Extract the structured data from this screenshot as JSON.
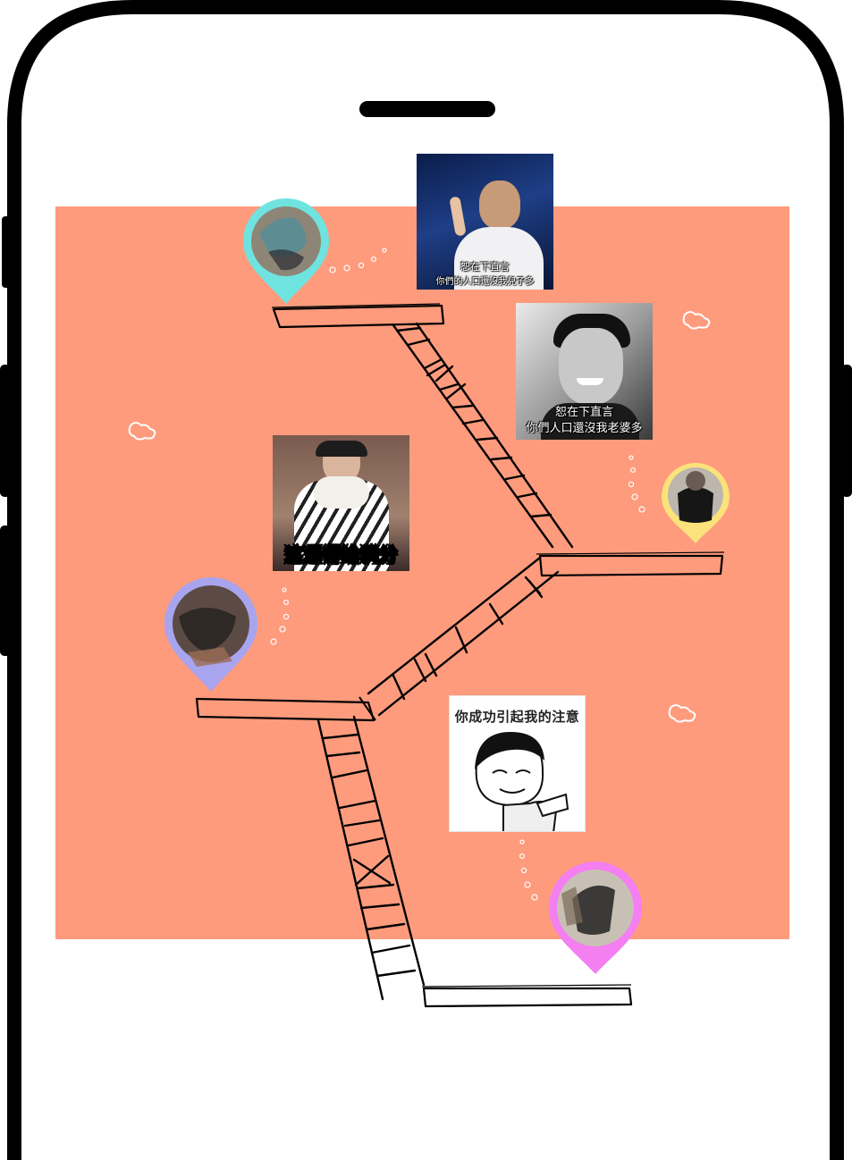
{
  "colors": {
    "screen_bg": "#ffffff",
    "board_bg": "#fe9b7d",
    "frame": "#000000",
    "pin_cyan": "#6fe3e0",
    "pin_yellow": "#fbe27b",
    "pin_purple": "#a9a4ee",
    "pin_pink": "#f37ff0"
  },
  "phone": {
    "speaker_icon": "speaker-slot",
    "buttons": [
      "left-button-top",
      "left-button-mid",
      "left-button-bottom",
      "right-button"
    ]
  },
  "memes": [
    {
      "id": "meme-businessman",
      "caption_line1": "恕在下直言",
      "caption_line2": "你們的人口還沒我兒子多"
    },
    {
      "id": "meme-smiling-man",
      "caption_line1": "恕在下直言",
      "caption_line2": "你們人口還沒我老婆多"
    },
    {
      "id": "meme-scarf-man",
      "caption": "这逼得给满分"
    },
    {
      "id": "meme-panda-face",
      "caption": "你成功引起我的注意"
    }
  ],
  "pins": [
    {
      "id": "pin-cyan",
      "color": "cyan"
    },
    {
      "id": "pin-yellow",
      "color": "yellow"
    },
    {
      "id": "pin-purple",
      "color": "purple"
    },
    {
      "id": "pin-pink",
      "color": "pink"
    }
  ],
  "doodles": [
    "cloud-doodle-left",
    "cloud-doodle-top-right",
    "cloud-doodle-bottom-right"
  ]
}
